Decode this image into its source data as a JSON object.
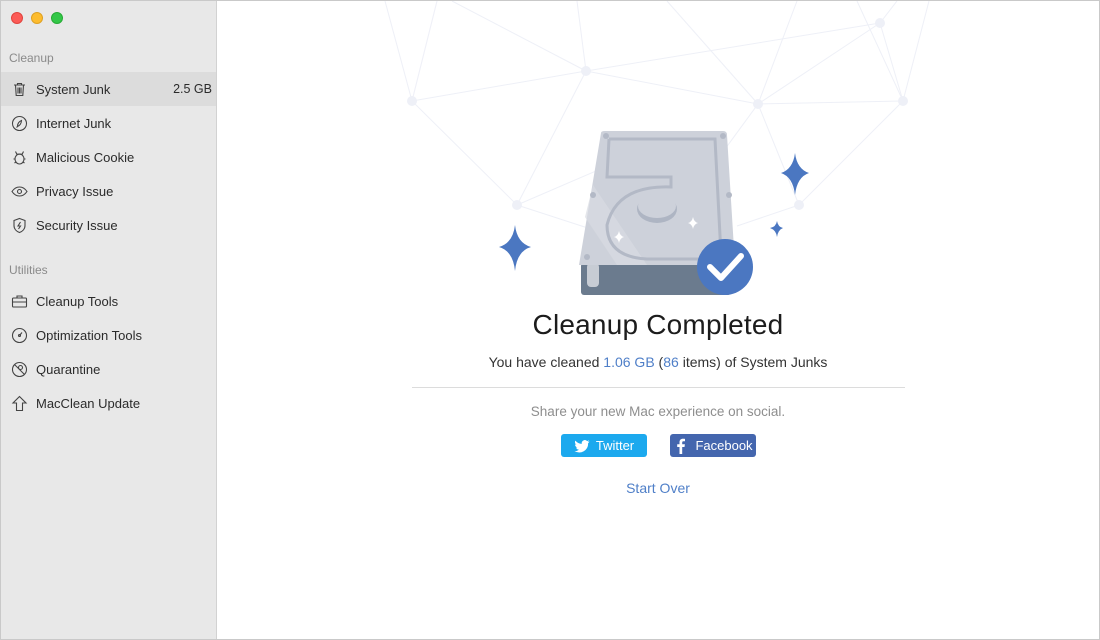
{
  "window": {
    "traffic_lights": [
      "close",
      "minimize",
      "maximize"
    ]
  },
  "sidebar": {
    "sections": [
      {
        "label": "Cleanup",
        "items": [
          {
            "label": "System Junk",
            "badge": "2.5 GB",
            "icon": "trash-icon",
            "active": true
          },
          {
            "label": "Internet Junk",
            "badge": "",
            "icon": "compass-leaf-icon",
            "active": false
          },
          {
            "label": "Malicious Cookie",
            "badge": "",
            "icon": "bug-icon",
            "active": false
          },
          {
            "label": "Privacy Issue",
            "badge": "",
            "icon": "eye-icon",
            "active": false
          },
          {
            "label": "Security Issue",
            "badge": "",
            "icon": "shield-bolt-icon",
            "active": false
          }
        ]
      },
      {
        "label": "Utilities",
        "items": [
          {
            "label": "Cleanup Tools",
            "icon": "toolbox-icon"
          },
          {
            "label": "Optimization Tools",
            "icon": "gauge-icon"
          },
          {
            "label": "Quarantine",
            "icon": "quarantine-icon"
          },
          {
            "label": "MacClean Update",
            "icon": "arrow-up-icon"
          }
        ]
      }
    ]
  },
  "main": {
    "title": "Cleanup Completed",
    "summary": {
      "prefix": "You have cleaned ",
      "size": "1.06 GB",
      "open_paren": " (",
      "count": "86",
      "suffix": " items) of System Junks"
    },
    "share_text": "Share your new Mac experience on social.",
    "twitter_label": "Twitter",
    "facebook_label": "Facebook",
    "start_over_label": "Start Over",
    "colors": {
      "accent": "#4f7fc8",
      "twitter": "#1ca9ee",
      "facebook": "#4466ae"
    }
  }
}
